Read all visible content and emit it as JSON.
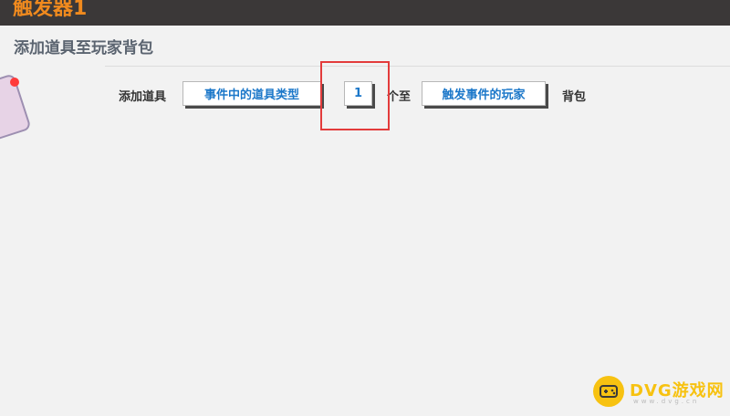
{
  "window": {
    "title": "触发器1"
  },
  "section": {
    "title": "添加道具至玩家背包"
  },
  "action_row": {
    "prefix_label": "添加道具",
    "item_type_button": "事件中的道具类型",
    "quantity_button": "1",
    "quantity_suffix": "个至",
    "target_player_button": "触发事件的玩家",
    "suffix_label": "背包"
  },
  "watermark": {
    "brand": "DVG游戏网",
    "url": "www.dvg.cn"
  },
  "colors": {
    "title_orange": "#f08a1e",
    "button_text": "#1b77c9",
    "highlight_red": "#e33b3b"
  }
}
